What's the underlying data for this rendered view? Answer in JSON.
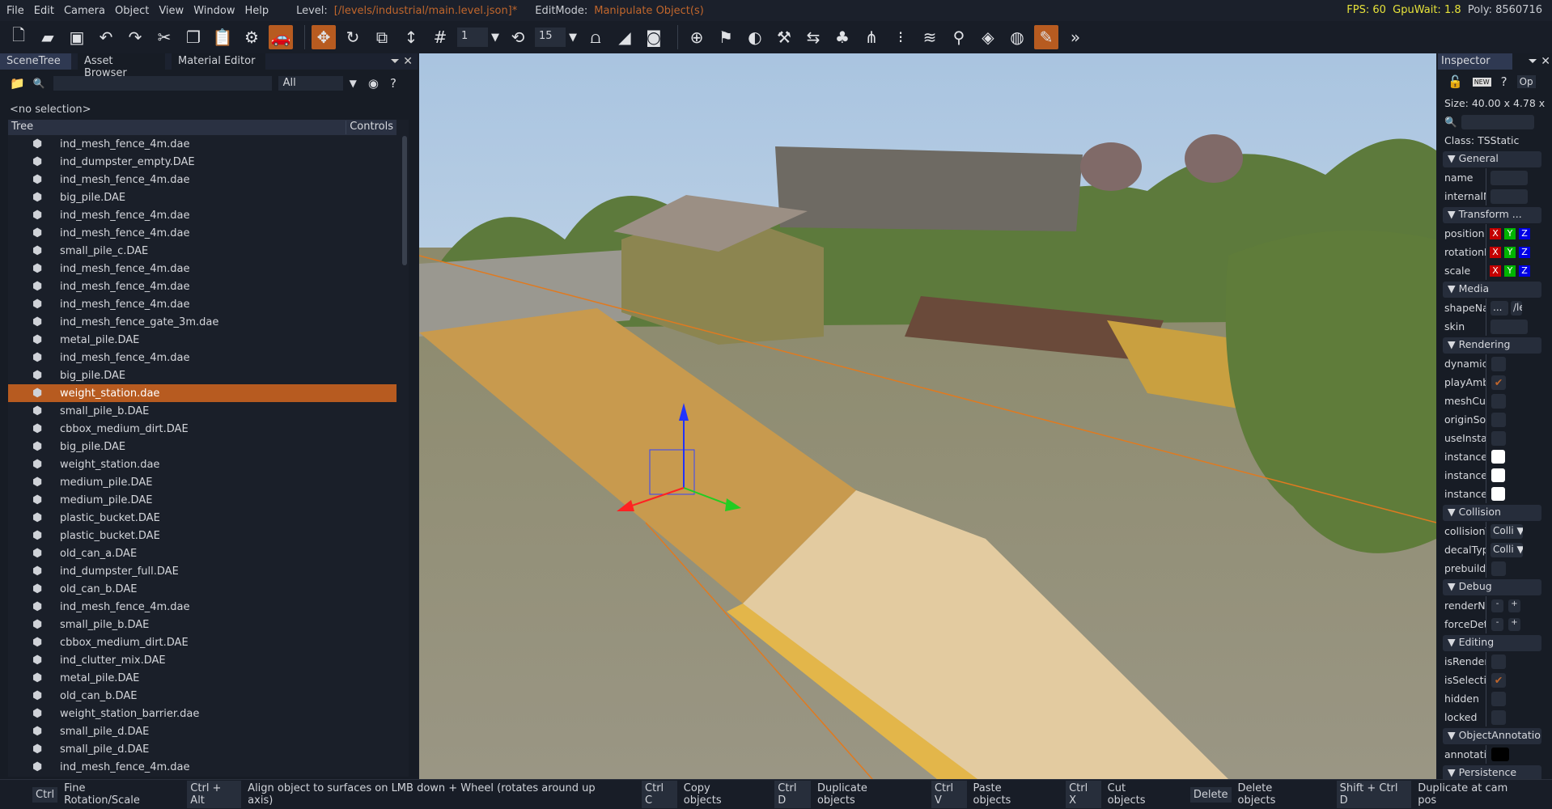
{
  "menu": [
    "File",
    "Edit",
    "Camera",
    "Object",
    "View",
    "Window",
    "Help"
  ],
  "level_label": "Level:",
  "level_value": "[/levels/industrial/main.level.json]*",
  "editmode_label": "EditMode:",
  "editmode_value": "Manipulate Object(s)",
  "stats": {
    "fps": "FPS: 60",
    "gpu": "GpuWait: 1.8",
    "poly": "Poly: 8560716"
  },
  "toolbar": {
    "snap_value": "1",
    "rotate_snap_value": "15"
  },
  "left_panel": {
    "tabs": [
      "SceneTree",
      "Asset Browser",
      "Material Editor"
    ],
    "filter": "All",
    "no_selection": "<no selection>",
    "col_tree": "Tree",
    "col_controls": "Controls",
    "items": [
      "ind_mesh_fence_4m.dae",
      "ind_dumpster_empty.DAE",
      "ind_mesh_fence_4m.dae",
      "big_pile.DAE",
      "ind_mesh_fence_4m.dae",
      "ind_mesh_fence_4m.dae",
      "small_pile_c.DAE",
      "ind_mesh_fence_4m.dae",
      "ind_mesh_fence_4m.dae",
      "ind_mesh_fence_4m.dae",
      "ind_mesh_fence_gate_3m.dae",
      "metal_pile.DAE",
      "ind_mesh_fence_4m.dae",
      "big_pile.DAE",
      "weight_station.dae",
      "small_pile_b.DAE",
      "cbbox_medium_dirt.DAE",
      "big_pile.DAE",
      "weight_station.dae",
      "medium_pile.DAE",
      "medium_pile.DAE",
      "plastic_bucket.DAE",
      "plastic_bucket.DAE",
      "old_can_a.DAE",
      "ind_dumpster_full.DAE",
      "old_can_b.DAE",
      "ind_mesh_fence_4m.dae",
      "small_pile_b.DAE",
      "cbbox_medium_dirt.DAE",
      "ind_clutter_mix.DAE",
      "metal_pile.DAE",
      "old_can_b.DAE",
      "weight_station_barrier.dae",
      "small_pile_d.DAE",
      "small_pile_d.DAE",
      "ind_mesh_fence_4m.dae"
    ],
    "selected_index": 14
  },
  "inspector": {
    "title": "Inspector",
    "new_badge": "NEW",
    "op_label": "Op",
    "size": "Size: 40.00 x 4.78 x",
    "class": "Class:  TSStatic",
    "sections": {
      "general": "General",
      "transform": "Transform",
      "media": "Media",
      "rendering": "Rendering",
      "collision": "Collision",
      "debug": "Debug",
      "editing": "Editing",
      "annotation": "ObjectAnnotation",
      "persistence": "Persistence"
    },
    "fields": {
      "name": "name",
      "internalName": "internalN",
      "position": "position",
      "rotation": "rotationE",
      "scale": "scale",
      "shapeName": "shapeNar",
      "shapePath": "/le",
      "shapeBrowse": "...",
      "skin": "skin",
      "dynamic": "dynamic",
      "playAmbient": "playAmbi",
      "meshCull": "meshCull",
      "originSort": "originSor",
      "useInstance": "useInstar",
      "instance1": "instanceC",
      "instance2": "instanceC",
      "instance3": "instanceC",
      "collisionType": "collisionT",
      "collisionValue": "Colli",
      "decalType": "decalTyp",
      "decalValue": "Colli",
      "prebuild": "prebuildC",
      "renderNormals": "renderNc",
      "forceDetail": "forceDeta",
      "isRenderEnabled": "isRenderI",
      "isSelection": "isSelectio",
      "hidden": "hidden",
      "locked": "locked",
      "annotation": "annotatic",
      "transform_more": "...",
      "x": "X",
      "y": "Y",
      "z": "Z",
      "minus": "-",
      "plus": "+"
    }
  },
  "shortcuts": [
    {
      "key": "Ctrl",
      "desc": "Fine Rotation/Scale"
    },
    {
      "key": "Ctrl + Alt",
      "desc": "Align object to surfaces on LMB down + Wheel (rotates around up axis)"
    },
    {
      "key": "Ctrl C",
      "desc": "Copy objects"
    },
    {
      "key": "Ctrl D",
      "desc": "Duplicate objects"
    },
    {
      "key": "Ctrl V",
      "desc": "Paste objects"
    },
    {
      "key": "Ctrl X",
      "desc": "Cut objects"
    },
    {
      "key": "Delete",
      "desc": "Delete objects"
    },
    {
      "key": "Shift + Ctrl D",
      "desc": "Duplicate at cam pos"
    }
  ],
  "colors": {
    "accent": "#b75b20",
    "x": "#c40000",
    "y": "#00b400",
    "z": "#0000e6"
  }
}
